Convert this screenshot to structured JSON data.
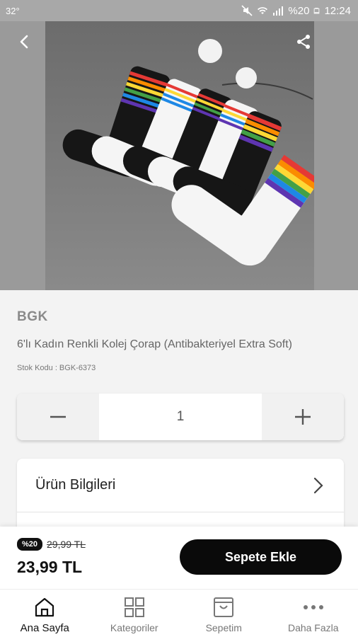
{
  "status_bar": {
    "temperature": "32°",
    "battery": "%20",
    "time": "12:24"
  },
  "product": {
    "brand": "BGK",
    "title": "6'lı Kadın Renkli Kolej Çorap (Antibakteriyel Extra Soft)",
    "stock_code": "Stok Kodu : BGK-6373",
    "image_icon": "product-photo-socks"
  },
  "quantity": {
    "value": "1",
    "decrease_icon": "minus-icon",
    "increase_icon": "plus-icon"
  },
  "info_sections": [
    {
      "label": "Ürün Bilgileri"
    }
  ],
  "purchase": {
    "discount_badge": "%20",
    "old_price": "29,99 TL",
    "new_price": "23,99 TL",
    "add_to_cart_label": "Sepete Ekle"
  },
  "bottom_nav": {
    "items": [
      {
        "label": "Ana Sayfa",
        "icon": "home-icon",
        "active": true
      },
      {
        "label": "Kategoriler",
        "icon": "grid-icon",
        "active": false
      },
      {
        "label": "Sepetim",
        "icon": "bag-icon",
        "active": false
      },
      {
        "label": "Daha Fazla",
        "icon": "more-dots-icon",
        "active": false
      }
    ]
  },
  "colors": {
    "accent": "#0a0a0a",
    "background": "#f3f3f3",
    "status_bar": "#a8a8a8"
  }
}
